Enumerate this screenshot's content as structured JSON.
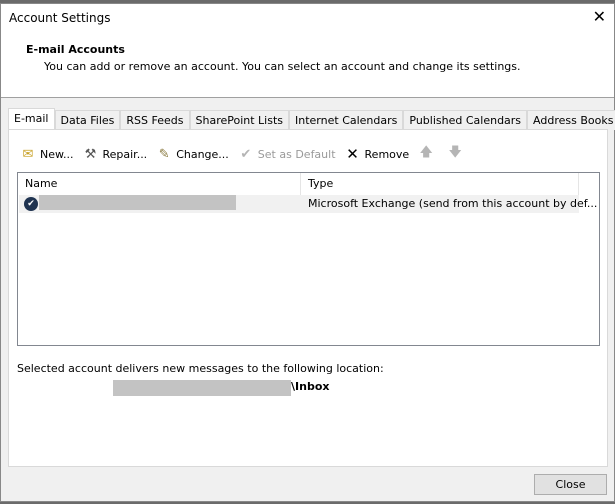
{
  "window": {
    "title": "Account Settings",
    "close_icon": "close-icon"
  },
  "header": {
    "title": "E-mail Accounts",
    "subtitle": "You can add or remove an account. You can select an account and change its settings."
  },
  "tabs": [
    {
      "label": "E-mail",
      "selected": true
    },
    {
      "label": "Data Files"
    },
    {
      "label": "RSS Feeds"
    },
    {
      "label": "SharePoint Lists"
    },
    {
      "label": "Internet Calendars"
    },
    {
      "label": "Published Calendars"
    },
    {
      "label": "Address Books"
    }
  ],
  "toolbar": {
    "new": "New...",
    "repair": "Repair...",
    "change": "Change...",
    "set_default": "Set as Default",
    "remove": "Remove"
  },
  "list": {
    "columns": [
      "Name",
      "Type"
    ],
    "rows": [
      {
        "name": "",
        "type": "Microsoft Exchange (send from this account by def..."
      }
    ]
  },
  "location": {
    "label": "Selected account delivers new messages to the following location:",
    "folder": "\\Inbox"
  },
  "footer": {
    "close": "Close"
  }
}
